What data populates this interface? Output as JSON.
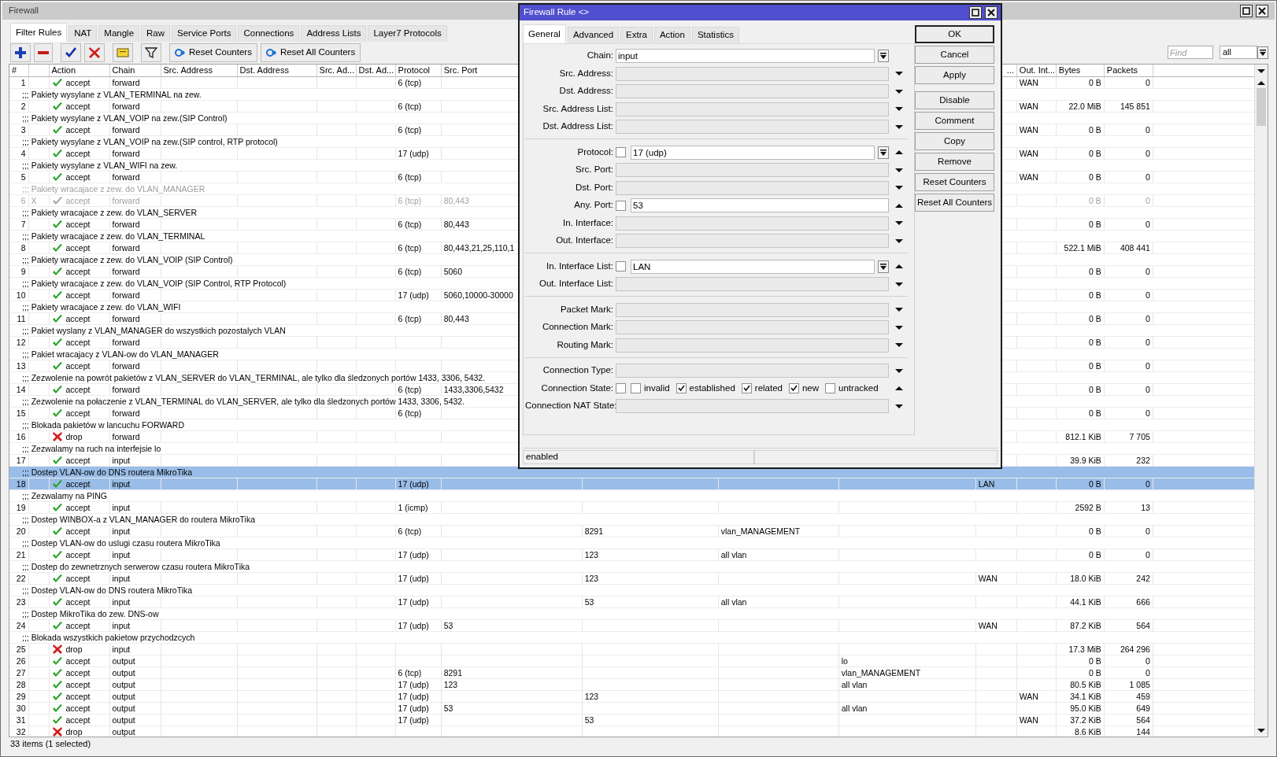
{
  "window": {
    "title": "Firewall"
  },
  "tabs": [
    {
      "label": "Filter Rules",
      "selected": true
    },
    {
      "label": "NAT",
      "selected": false
    },
    {
      "label": "Mangle",
      "selected": false
    },
    {
      "label": "Raw",
      "selected": false
    },
    {
      "label": "Service Ports",
      "selected": false
    },
    {
      "label": "Connections",
      "selected": false
    },
    {
      "label": "Address Lists",
      "selected": false
    },
    {
      "label": "Layer7 Protocols",
      "selected": false
    }
  ],
  "toolbar": {
    "text_buttons": [
      "Reset Counters",
      "Reset All Counters"
    ],
    "find": {
      "placeholder": "Find"
    },
    "filter": {
      "value": "all"
    }
  },
  "table": {
    "columns": [
      {
        "label": "#"
      },
      {},
      {
        "label": "Action"
      },
      {
        "label": "Chain"
      },
      {
        "label": "Src. Address"
      },
      {
        "label": "Dst. Address"
      },
      {
        "label": "Src. Ad..."
      },
      {
        "label": "Dst. Ad..."
      },
      {
        "label": "Protocol"
      },
      {
        "label": "Src. Port"
      },
      {},
      {},
      {},
      {
        "label": "..."
      },
      {
        "label": "Out. Int..."
      },
      {
        "label": "Bytes"
      },
      {
        "label": "Packets"
      }
    ],
    "rules": [
      {
        "number": "1",
        "kind": "accept",
        "action": "accept",
        "chain": "forward",
        "protocol": "6 (tcp)",
        "out_interface": "WAN",
        "bytes": "0 B",
        "packets": "0",
        "selected": false,
        "disabled": false
      },
      {
        "comment": ";;; Pakiety wysylane z VLAN_TERMINAL na zew.",
        "number": "2",
        "kind": "accept",
        "action": "accept",
        "chain": "forward",
        "protocol": "6 (tcp)",
        "out_interface": "WAN",
        "bytes": "22.0 MiB",
        "packets": "145 851",
        "selected": false,
        "disabled": false
      },
      {
        "comment": ";;; Pakiety wysylane z VLAN_VOIP na zew.(SIP Control)",
        "number": "3",
        "kind": "accept",
        "action": "accept",
        "chain": "forward",
        "protocol": "6 (tcp)",
        "out_interface": "WAN",
        "bytes": "0 B",
        "packets": "0",
        "selected": false,
        "disabled": false
      },
      {
        "comment": ";;; Pakiety wysylane z VLAN_VOIP na zew.(SIP control, RTP protocol)",
        "number": "4",
        "kind": "accept",
        "action": "accept",
        "chain": "forward",
        "protocol": "17 (udp)",
        "out_interface": "WAN",
        "bytes": "0 B",
        "packets": "0",
        "selected": false,
        "disabled": false
      },
      {
        "comment": ";;; Pakiety wysylane z VLAN_WIFI na zew.",
        "number": "5",
        "kind": "accept",
        "action": "accept",
        "chain": "forward",
        "protocol": "6 (tcp)",
        "out_interface": "WAN",
        "bytes": "0 B",
        "packets": "0",
        "selected": false,
        "disabled": false
      },
      {
        "comment": ";;; Pakiety wracajace z zew. do VLAN_MANAGER",
        "number": "6",
        "flag": "X",
        "kind": "accept",
        "action": "accept",
        "chain": "forward",
        "protocol": "6 (tcp)",
        "src_port": "80,443",
        "bytes": "0 B",
        "packets": "0",
        "selected": false,
        "disabled": true
      },
      {
        "comment": ";;; Pakiety wracajace z zew. do VLAN_SERVER",
        "number": "7",
        "kind": "accept",
        "action": "accept",
        "chain": "forward",
        "protocol": "6 (tcp)",
        "src_port": "80,443",
        "bytes": "0 B",
        "packets": "0",
        "selected": false,
        "disabled": false
      },
      {
        "comment": ";;; Pakiety wracajace z zew. do VLAN_TERMINAL",
        "number": "8",
        "kind": "accept",
        "action": "accept",
        "chain": "forward",
        "protocol": "6 (tcp)",
        "src_port": "80,443,21,25,110,1",
        "bytes": "522.1 MiB",
        "packets": "408 441",
        "selected": false,
        "disabled": false
      },
      {
        "comment": ";;; Pakiety wracajace z zew. do VLAN_VOIP (SIP Control)",
        "number": "9",
        "kind": "accept",
        "action": "accept",
        "chain": "forward",
        "protocol": "6 (tcp)",
        "src_port": "5060",
        "bytes": "0 B",
        "packets": "0",
        "selected": false,
        "disabled": false
      },
      {
        "comment": ";;; Pakiety wracajace z zew. do VLAN_VOIP (SIP Control, RTP Protocol)",
        "number": "10",
        "kind": "accept",
        "action": "accept",
        "chain": "forward",
        "protocol": "17 (udp)",
        "src_port": "5060,10000-30000",
        "bytes": "0 B",
        "packets": "0",
        "selected": false,
        "disabled": false
      },
      {
        "comment": ";;; Pakiety wracajace z zew. do VLAN_WIFI",
        "number": "11",
        "kind": "accept",
        "action": "accept",
        "chain": "forward",
        "protocol": "6 (tcp)",
        "src_port": "80,443",
        "bytes": "0 B",
        "packets": "0",
        "selected": false,
        "disabled": false
      },
      {
        "comment": ";;; Pakiet wyslany z VLAN_MANAGER do wszystkich pozostalych VLAN",
        "number": "12",
        "kind": "accept",
        "action": "accept",
        "chain": "forward",
        "bytes": "0 B",
        "packets": "0",
        "selected": false,
        "disabled": false
      },
      {
        "comment": ";;; Pakiet wracajacy z VLAN-ow do VLAN_MANAGER",
        "number": "13",
        "kind": "accept",
        "action": "accept",
        "chain": "forward",
        "bytes": "0 B",
        "packets": "0",
        "selected": false,
        "disabled": false
      },
      {
        "comment": ";;; Zezwolenie na powrót pakietów z VLAN_SERVER do VLAN_TERMINAL, ale tylko dla śledzonych portów 1433, 3306, 5432.",
        "number": "14",
        "kind": "accept",
        "action": "accept",
        "chain": "forward",
        "protocol": "6 (tcp)",
        "src_port": "1433,3306,5432",
        "bytes": "0 B",
        "packets": "0",
        "selected": false,
        "disabled": false
      },
      {
        "comment": ";;; Zezwolenie na połaczenie z VLAN_TERMINAL do VLAN_SERVER, ale tylko dla śledzonych portów 1433, 3306, 5432.",
        "number": "15",
        "kind": "accept",
        "action": "accept",
        "chain": "forward",
        "protocol": "6 (tcp)",
        "bytes": "0 B",
        "packets": "0",
        "selected": false,
        "disabled": false
      },
      {
        "comment": ";;; Blokada pakietów w lancuchu FORWARD",
        "number": "16",
        "kind": "drop",
        "action": "drop",
        "chain": "forward",
        "bytes": "812.1 KiB",
        "packets": "7 705",
        "selected": false,
        "disabled": false
      },
      {
        "comment": ";;; Zezwalamy na ruch na interfejsie lo",
        "number": "17",
        "kind": "accept",
        "action": "accept",
        "chain": "input",
        "bytes": "39.9 KiB",
        "packets": "232",
        "selected": false,
        "disabled": false
      },
      {
        "comment": ";;; Dostep VLAN-ow do DNS routera MikroTika",
        "number": "18",
        "kind": "accept",
        "action": "accept",
        "chain": "input",
        "protocol": "17 (udp)",
        "column_14": "LAN",
        "bytes": "0 B",
        "packets": "0",
        "selected": true,
        "disabled": false
      },
      {
        "comment": ";;; Zezwalamy na PING",
        "number": "19",
        "kind": "accept",
        "action": "accept",
        "chain": "input",
        "protocol": "1 (icmp)",
        "bytes": "2592 B",
        "packets": "13",
        "selected": false,
        "disabled": false
      },
      {
        "comment": ";;; Dostep WINBOX-a z VLAN_MANAGER do routera MikroTika",
        "number": "20",
        "kind": "accept",
        "action": "accept",
        "chain": "input",
        "protocol": "6 (tcp)",
        "column_11": "8291",
        "column_12": "vlan_MANAGEMENT",
        "bytes": "0 B",
        "packets": "0",
        "selected": false,
        "disabled": false
      },
      {
        "comment": ";;; Dostep VLAN-ow do uslugi czasu routera MikroTika",
        "number": "21",
        "kind": "accept",
        "action": "accept",
        "chain": "input",
        "protocol": "17 (udp)",
        "column_11": "123",
        "column_12": "all vlan",
        "bytes": "0 B",
        "packets": "0",
        "selected": false,
        "disabled": false
      },
      {
        "comment": ";;; Dostep do zewnetrznych serwerow czasu routera MikroTika",
        "number": "22",
        "kind": "accept",
        "action": "accept",
        "chain": "input",
        "protocol": "17 (udp)",
        "column_11": "123",
        "column_14": "WAN",
        "bytes": "18.0 KiB",
        "packets": "242",
        "selected": false,
        "disabled": false
      },
      {
        "comment": ";;; Dostep VLAN-ow do DNS routera MikroTika",
        "number": "23",
        "kind": "accept",
        "action": "accept",
        "chain": "input",
        "protocol": "17 (udp)",
        "column_11": "53",
        "column_12": "all vlan",
        "bytes": "44.1 KiB",
        "packets": "666",
        "selected": false,
        "disabled": false
      },
      {
        "comment": ";;; Dostep MikroTika do zew. DNS-ow",
        "number": "24",
        "kind": "accept",
        "action": "accept",
        "chain": "input",
        "protocol": "17 (udp)",
        "src_port": "53",
        "column_14": "WAN",
        "bytes": "87.2 KiB",
        "packets": "564",
        "selected": false,
        "disabled": false
      },
      {
        "comment": ";;; Blokada wszystkich pakietow przychodzcych",
        "number": "25",
        "kind": "drop",
        "action": "drop",
        "chain": "input",
        "bytes": "17.3 MiB",
        "packets": "264 296",
        "selected": false,
        "disabled": false
      },
      {
        "number": "26",
        "kind": "accept",
        "action": "accept",
        "chain": "output",
        "column_13": "lo",
        "bytes": "0 B",
        "packets": "0",
        "selected": false,
        "disabled": false
      },
      {
        "number": "27",
        "kind": "accept",
        "action": "accept",
        "chain": "output",
        "protocol": "6 (tcp)",
        "src_port": "8291",
        "column_13": "vlan_MANAGEMENT",
        "bytes": "0 B",
        "packets": "0",
        "selected": false,
        "disabled": false
      },
      {
        "number": "28",
        "kind": "accept",
        "action": "accept",
        "chain": "output",
        "protocol": "17 (udp)",
        "src_port": "123",
        "column_13": "all vlan",
        "bytes": "80.5 KiB",
        "packets": "1 085",
        "selected": false,
        "disabled": false
      },
      {
        "number": "29",
        "kind": "accept",
        "action": "accept",
        "chain": "output",
        "protocol": "17 (udp)",
        "column_11": "123",
        "out_interface": "WAN",
        "bytes": "34.1 KiB",
        "packets": "459",
        "selected": false,
        "disabled": false
      },
      {
        "number": "30",
        "kind": "accept",
        "action": "accept",
        "chain": "output",
        "protocol": "17 (udp)",
        "src_port": "53",
        "column_13": "all vlan",
        "bytes": "95.0 KiB",
        "packets": "649",
        "selected": false,
        "disabled": false
      },
      {
        "number": "31",
        "kind": "accept",
        "action": "accept",
        "chain": "output",
        "protocol": "17 (udp)",
        "column_11": "53",
        "out_interface": "WAN",
        "bytes": "37.2 KiB",
        "packets": "564",
        "selected": false,
        "disabled": false
      },
      {
        "number": "32",
        "kind": "drop",
        "action": "drop",
        "chain": "output",
        "bytes": "8.6 KiB",
        "packets": "144",
        "selected": false,
        "disabled": false
      }
    ]
  },
  "status_bar": "33 items (1 selected)",
  "dialog": {
    "title": "Firewall Rule <>",
    "tabs": [
      {
        "label": "General",
        "selected": true
      },
      {
        "label": "Advanced",
        "selected": false
      },
      {
        "label": "Extra",
        "selected": false
      },
      {
        "label": "Action",
        "selected": false
      },
      {
        "label": "Statistics",
        "selected": false
      }
    ],
    "groups": [
      [
        {
          "kind": "select",
          "label": "Chain:",
          "value": "input"
        },
        {
          "kind": "empty",
          "label": "Src. Address:",
          "expanded": false
        },
        {
          "kind": "empty",
          "label": "Dst. Address:",
          "expanded": false
        },
        {
          "kind": "empty",
          "label": "Src. Address List:",
          "expanded": false
        },
        {
          "kind": "empty",
          "label": "Dst. Address List:",
          "expanded": false
        }
      ],
      [
        {
          "kind": "combo",
          "label": "Protocol:",
          "negated": false,
          "value": "17 (udp)",
          "expanded": true
        },
        {
          "kind": "empty",
          "label": "Src. Port:",
          "expanded": false
        },
        {
          "kind": "empty",
          "label": "Dst. Port:",
          "expanded": false
        },
        {
          "kind": "text",
          "label": "Any. Port:",
          "negated": false,
          "value": "53",
          "expanded": true
        },
        {
          "kind": "empty",
          "label": "In. Interface:",
          "expanded": false
        },
        {
          "kind": "empty",
          "label": "Out. Interface:",
          "expanded": false
        }
      ],
      [
        {
          "kind": "combo",
          "label": "In. Interface List:",
          "negated": false,
          "value": "LAN",
          "expanded": true
        },
        {
          "kind": "empty",
          "label": "Out. Interface List:",
          "expanded": false
        }
      ],
      [
        {
          "kind": "empty",
          "label": "Packet Mark:",
          "expanded": false
        },
        {
          "kind": "empty",
          "label": "Connection Mark:",
          "expanded": false
        },
        {
          "kind": "empty",
          "label": "Routing Mark:",
          "expanded": false
        }
      ],
      [
        {
          "kind": "empty",
          "label": "Connection Type:",
          "expanded": false
        },
        {
          "kind": "states",
          "label": "Connection State:",
          "negated": false,
          "expanded": true,
          "options": [
            {
              "label": "invalid",
              "checked": false
            },
            {
              "label": "established",
              "checked": true
            },
            {
              "label": "related",
              "checked": true
            },
            {
              "label": "new",
              "checked": true
            },
            {
              "label": "untracked",
              "checked": false
            }
          ]
        },
        {
          "kind": "empty",
          "label": "Connection NAT State:",
          "expanded": false
        }
      ]
    ],
    "buttons": [
      {
        "label": "OK",
        "default": true
      },
      {
        "label": "Cancel",
        "default": false
      },
      {
        "label": "Apply",
        "default": false
      },
      {
        "label": "Disable",
        "default": false
      },
      {
        "label": "Comment",
        "default": false
      },
      {
        "label": "Copy",
        "default": false
      },
      {
        "label": "Remove",
        "default": false
      },
      {
        "label": "Reset Counters",
        "default": false
      },
      {
        "label": "Reset All Counters",
        "default": false
      }
    ],
    "status": "enabled"
  }
}
